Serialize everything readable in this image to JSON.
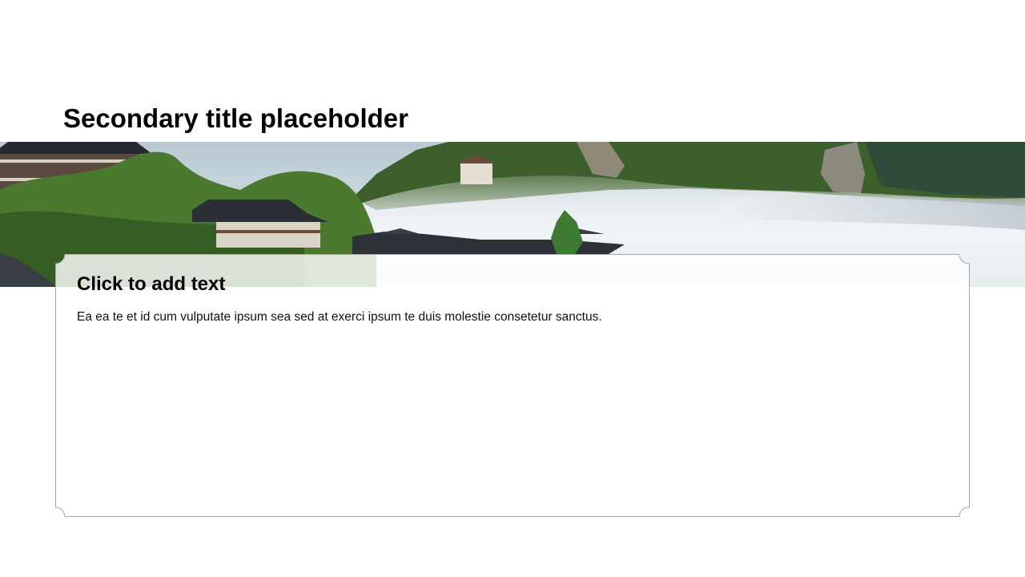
{
  "slide": {
    "title": "Secondary title placeholder",
    "banner": {
      "image": "mountain-temple-mist-landscape",
      "colors": {
        "sky": "#c9d5db",
        "forest": "#3f6b2a",
        "mist": "#eef2f4",
        "roof": "#2b2f36"
      }
    },
    "card": {
      "heading": "Click to add text",
      "body": "Ea ea te et id cum vulputate ipsum sea sed at exerci ipsum te duis molestie consetetur sanctus.",
      "border_color": "#a8a8a8",
      "fill": "#ffffff"
    }
  }
}
